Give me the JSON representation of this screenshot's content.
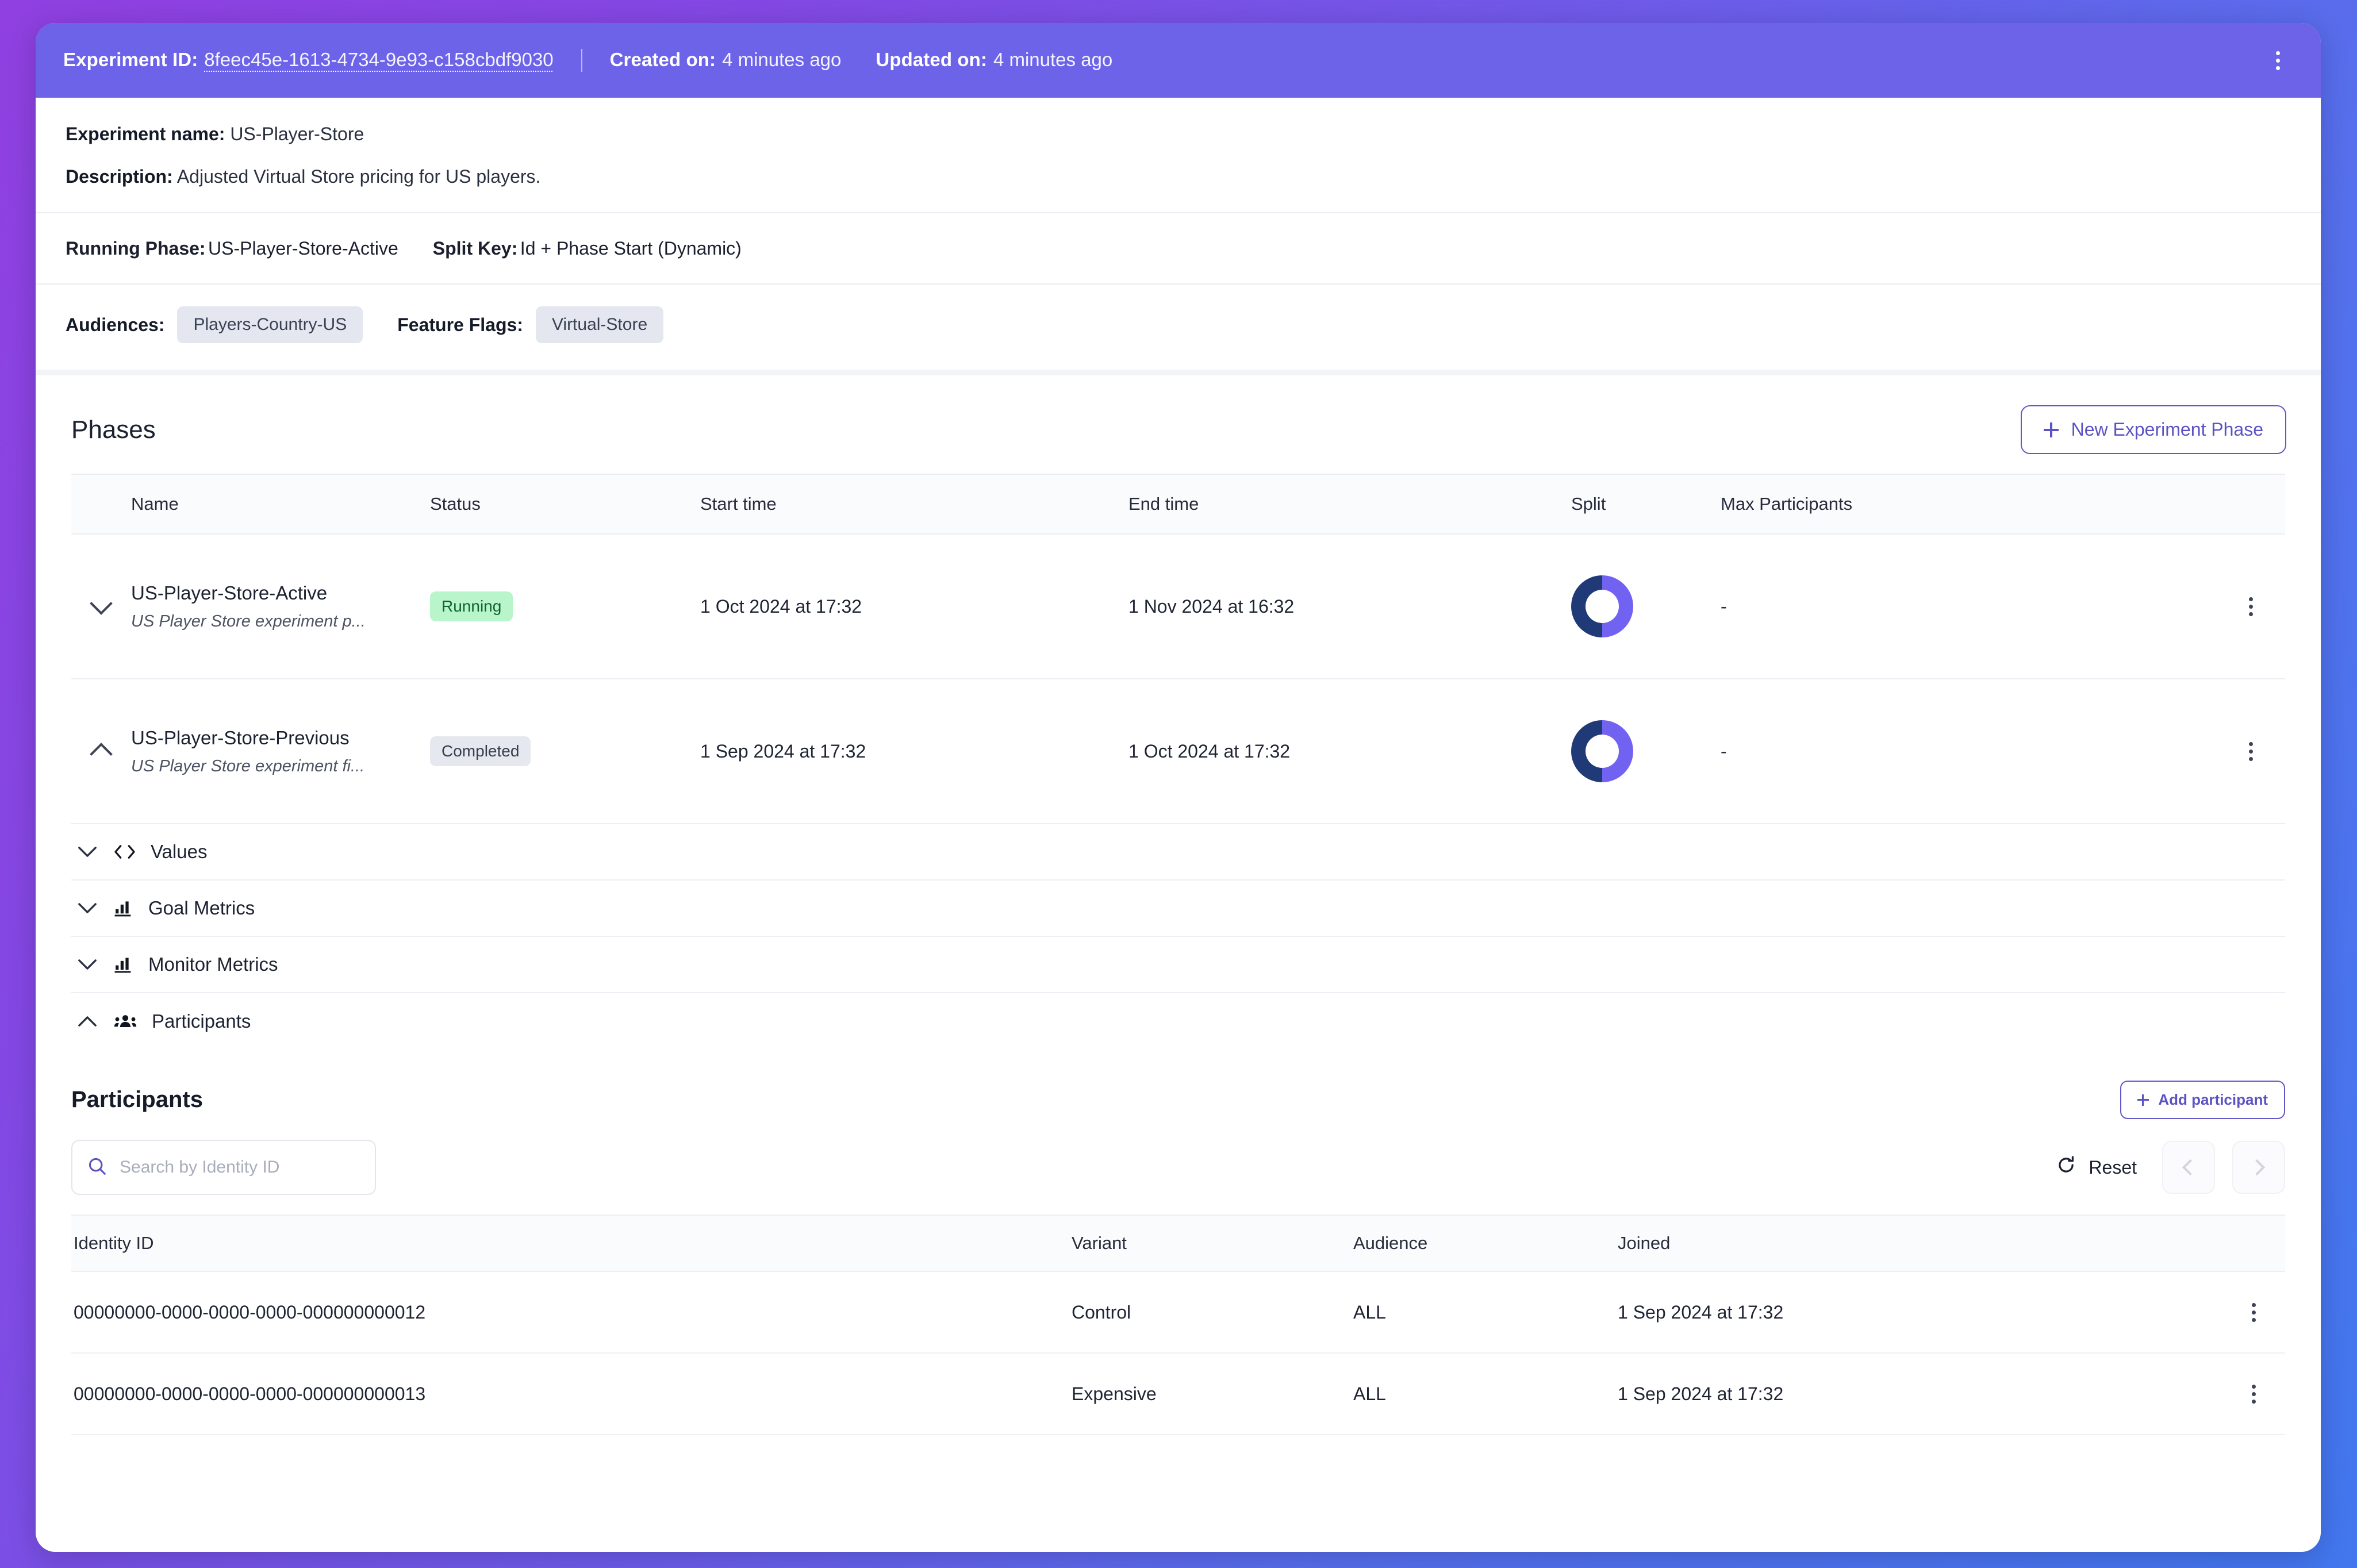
{
  "topbar": {
    "experiment_id_label": "Experiment ID:",
    "experiment_id": "8feec45e-1613-4734-9e93-c158cbdf9030",
    "created_label": "Created on:",
    "created_value": "4 minutes ago",
    "updated_label": "Updated on:",
    "updated_value": "4 minutes ago",
    "menu_icon": "kebab-menu-icon",
    "bg_color": "#6C63E8"
  },
  "meta": {
    "name_label": "Experiment name:",
    "name_value": "US-Player-Store",
    "description_label": "Description:",
    "description_value": "Adjusted Virtual Store pricing for US players.",
    "running_phase_label": "Running Phase:",
    "running_phase_value": "US-Player-Store-Active",
    "split_key_label": "Split Key:",
    "split_key_value": "Id + Phase Start (Dynamic)",
    "audiences_label": "Audiences:",
    "audiences": [
      "Players-Country-US"
    ],
    "feature_flags_label": "Feature Flags:",
    "feature_flags": [
      "Virtual-Store"
    ]
  },
  "phases": {
    "title": "Phases",
    "new_phase_button": "New Experiment Phase",
    "new_phase_icon": "plus-icon",
    "columns": [
      "Name",
      "Status",
      "Start time",
      "End time",
      "Split",
      "Max Participants"
    ],
    "rows": [
      {
        "caret": "chevron-down-icon",
        "name": "US-Player-Store-Active",
        "description": "US Player Store experiment p...",
        "status": "Running",
        "status_type": "running",
        "start_time": "1 Oct 2024 at 17:32",
        "end_time": "1 Nov 2024 at 16:32",
        "split": "50/50",
        "max_participants": "-"
      },
      {
        "caret": "chevron-up-icon",
        "name": "US-Player-Store-Previous",
        "description": "US Player Store experiment fi...",
        "status": "Completed",
        "status_type": "completed",
        "start_time": "1 Sep 2024 at 17:32",
        "end_time": "1 Oct 2024 at 17:32",
        "split": "50/50",
        "max_participants": "-"
      }
    ]
  },
  "accordion": [
    {
      "label": "Values",
      "icon": "code-brackets-icon",
      "caret": "chevron-down-icon",
      "expanded": false
    },
    {
      "label": "Goal Metrics",
      "icon": "bar-chart-icon",
      "caret": "chevron-down-icon",
      "expanded": false
    },
    {
      "label": "Monitor Metrics",
      "icon": "bar-chart-icon",
      "caret": "chevron-down-icon",
      "expanded": false
    },
    {
      "label": "Participants",
      "icon": "people-icon",
      "caret": "chevron-up-icon",
      "expanded": true
    }
  ],
  "participants": {
    "title": "Participants",
    "add_button": "Add participant",
    "add_icon": "plus-icon",
    "search_placeholder": "Search by Identity ID",
    "search_value": "",
    "search_icon": "search-icon",
    "reset_label": "Reset",
    "reset_icon": "refresh-icon",
    "prev_icon": "chevron-left-icon",
    "next_icon": "chevron-right-icon",
    "columns": [
      "Identity ID",
      "Variant",
      "Audience",
      "Joined"
    ],
    "rows": [
      {
        "identity_id": "00000000-0000-0000-0000-000000000012",
        "variant": "Control",
        "audience": "ALL",
        "joined": "1 Sep 2024 at 17:32"
      },
      {
        "identity_id": "00000000-0000-0000-0000-000000000013",
        "variant": "Expensive",
        "audience": "ALL",
        "joined": "1 Sep 2024 at 17:32"
      }
    ]
  },
  "colors": {
    "accent": "#6C63E8",
    "accent_outline": "#5b52c4",
    "split_dark": "#203a78",
    "split_light": "#7162F2",
    "running_badge_bg": "#b8f5cb",
    "running_badge_text": "#12622f",
    "completed_badge_bg": "#e6e8ef"
  }
}
